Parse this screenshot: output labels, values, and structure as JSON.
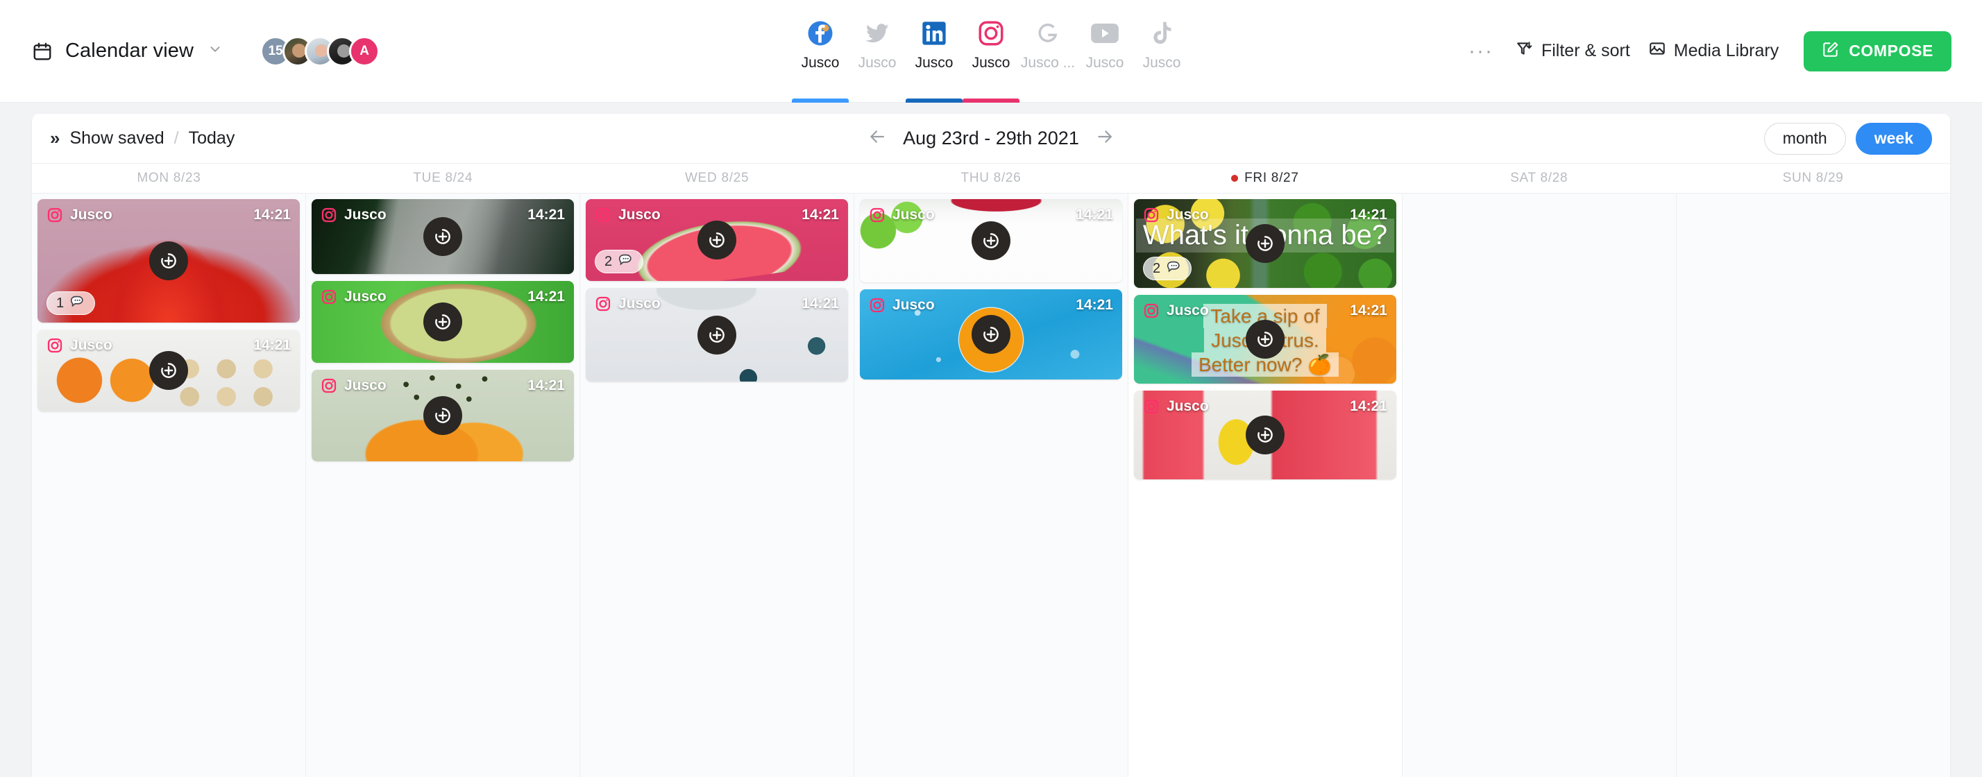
{
  "header": {
    "calendar_icon": "calendar-icon",
    "view_label": "Calendar view",
    "chevron_icon": "chevron-down-icon",
    "avatars": [
      {
        "type": "count",
        "label": "15"
      },
      {
        "type": "photo",
        "label": ""
      },
      {
        "type": "photo",
        "label": ""
      },
      {
        "type": "photo",
        "label": ""
      },
      {
        "type": "initial",
        "label": "A"
      }
    ],
    "avatar_overflow_count": "15",
    "avatar_initial": "A",
    "accent_pink": "#e8336e"
  },
  "networks": [
    {
      "id": "facebook",
      "icon": "facebook-icon",
      "label": "Jusco",
      "active": true,
      "underline": "#3b9bff"
    },
    {
      "id": "twitter",
      "icon": "twitter-icon",
      "label": "Jusco",
      "active": false,
      "underline": ""
    },
    {
      "id": "linkedin",
      "icon": "linkedin-icon",
      "label": "Jusco",
      "active": true,
      "underline": "#1669bb"
    },
    {
      "id": "instagram",
      "icon": "instagram-icon",
      "label": "Jusco",
      "active": true,
      "underline": "#e8336e"
    },
    {
      "id": "google",
      "icon": "google-business-icon",
      "label": "Jusco ...",
      "active": false,
      "underline": ""
    },
    {
      "id": "youtube",
      "icon": "youtube-icon",
      "label": "Jusco",
      "active": false,
      "underline": ""
    },
    {
      "id": "tiktok",
      "icon": "tiktok-icon",
      "label": "Jusco",
      "active": false,
      "underline": ""
    }
  ],
  "toolbar": {
    "more_label": "···",
    "filter_label": "Filter & sort",
    "filter_icon": "filter-icon",
    "media_label": "Media Library",
    "media_icon": "image-icon",
    "compose_label": "COMPOSE",
    "compose_icon": "pencil-compose-icon",
    "compose_color": "#23c55e"
  },
  "subbar": {
    "expand_icon": "chevron-double-right-icon",
    "show_saved_label": "Show saved",
    "separator": "/",
    "today_label": "Today",
    "prev_icon": "arrow-left-icon",
    "next_icon": "arrow-right-icon",
    "date_range": "Aug 23rd - 29th 2021",
    "month_label": "month",
    "week_label": "week",
    "active_range": "week",
    "active_color": "#2f8cf5"
  },
  "days": [
    {
      "label": "MON 8/23",
      "is_today": false
    },
    {
      "label": "TUE 8/24",
      "is_today": false
    },
    {
      "label": "WED 8/25",
      "is_today": false
    },
    {
      "label": "THU 8/26",
      "is_today": false
    },
    {
      "label": "FRI 8/27",
      "is_today": true
    },
    {
      "label": "SAT 8/28",
      "is_today": false
    },
    {
      "label": "SUN 8/29",
      "is_today": false
    }
  ],
  "posts": {
    "mon": [
      {
        "brand": "Jusco",
        "network": "instagram-icon",
        "time": "14:21",
        "comments": "1",
        "art": "art-strawberry",
        "height": 178,
        "caption": []
      },
      {
        "brand": "Jusco",
        "network": "instagram-icon",
        "time": "14:21",
        "comments": "",
        "art": "art-apricot",
        "height": 118,
        "caption": []
      }
    ],
    "tue": [
      {
        "brand": "Jusco",
        "network": "instagram-icon",
        "time": "14:21",
        "comments": "",
        "art": "art-detox",
        "height": 108,
        "caption": []
      },
      {
        "brand": "Jusco",
        "network": "instagram-icon",
        "time": "14:21",
        "comments": "",
        "art": "art-melon",
        "height": 118,
        "caption": []
      },
      {
        "brand": "Jusco",
        "network": "instagram-icon",
        "time": "14:21",
        "comments": "",
        "art": "art-papaya",
        "height": 132,
        "caption": []
      }
    ],
    "wed": [
      {
        "brand": "Jusco",
        "network": "instagram-icon",
        "time": "14:21",
        "comments": "2",
        "art": "art-watermelon",
        "height": 118,
        "caption": []
      },
      {
        "brand": "Jusco",
        "network": "instagram-icon",
        "time": "14:21",
        "comments": "",
        "art": "art-berries",
        "height": 135,
        "caption": []
      }
    ],
    "thu": [
      {
        "brand": "Jusco",
        "network": "instagram-icon",
        "time": "14:21",
        "comments": "",
        "art": "art-mug",
        "height": 120,
        "caption": []
      },
      {
        "brand": "Jusco",
        "network": "instagram-icon",
        "time": "14:21",
        "comments": "",
        "art": "art-orange-water",
        "height": 130,
        "caption": []
      }
    ],
    "fri": [
      {
        "brand": "Jusco",
        "network": "instagram-icon",
        "time": "14:21",
        "comments": "2",
        "art": "art-citrus-duo",
        "height": 128,
        "caption": [
          "What's it gonna be?"
        ]
      },
      {
        "brand": "Jusco",
        "network": "instagram-icon",
        "time": "14:21",
        "comments": "",
        "art": "art-citrus-promo",
        "height": 128,
        "caption": [
          "Take a sip of",
          "Jusco citrus.",
          "Better now? 🍊"
        ]
      },
      {
        "brand": "Jusco",
        "network": "instagram-icon",
        "time": "14:21",
        "comments": "",
        "art": "art-smoothie",
        "height": 128,
        "caption": []
      }
    ],
    "sat": [],
    "sun": []
  },
  "card_controls": {
    "add_icon": "add-circle-icon",
    "comment_icon": "comment-bubble-icon"
  }
}
